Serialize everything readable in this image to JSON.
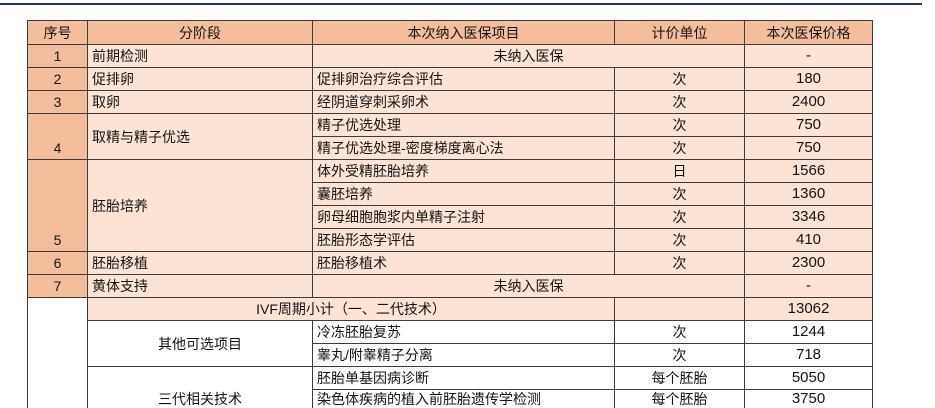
{
  "table": {
    "headers": {
      "index": "序号",
      "stage": "分阶段",
      "item": "本次纳入医保项目",
      "unit": "计价单位",
      "price": "本次医保价格"
    },
    "stages": [
      {
        "index": "1",
        "stage": "前期检测",
        "note": "未纳入医保",
        "price": "-"
      },
      {
        "index": "2",
        "stage": "促排卵",
        "items": [
          {
            "item": "促排卵治疗综合评估",
            "unit": "次",
            "price": "180"
          }
        ]
      },
      {
        "index": "3",
        "stage": "取卵",
        "items": [
          {
            "item": "经阴道穿刺采卵术",
            "unit": "次",
            "price": "2400"
          }
        ]
      },
      {
        "index": "4",
        "stage": "取精与精子优选",
        "items": [
          {
            "item": "精子优选处理",
            "unit": "次",
            "price": "750"
          },
          {
            "item": "精子优选处理-密度梯度离心法",
            "unit": "次",
            "price": "750"
          }
        ]
      },
      {
        "index": "5",
        "stage": "胚胎培养",
        "items": [
          {
            "item": "体外受精胚胎培养",
            "unit": "日",
            "price": "1566"
          },
          {
            "item": "囊胚培养",
            "unit": "次",
            "price": "1360"
          },
          {
            "item": "卵母细胞胞浆内单精子注射",
            "unit": "次",
            "price": "3346"
          },
          {
            "item": "胚胎形态学评估",
            "unit": "次",
            "price": "410"
          }
        ]
      },
      {
        "index": "6",
        "stage": "胚胎移植",
        "items": [
          {
            "item": "胚胎移植术",
            "unit": "次",
            "price": "2300"
          }
        ]
      },
      {
        "index": "7",
        "stage": "黄体支持",
        "note": "未纳入医保",
        "price": "-"
      }
    ],
    "subtotal": {
      "label": "IVF周期小计（一、二代技术）",
      "price": "13062"
    },
    "optional_groups": [
      {
        "group": "其他可选项目",
        "items": [
          {
            "item": "冷冻胚胎复苏",
            "unit": "次",
            "price": "1244"
          },
          {
            "item": "睾丸/附睾精子分离",
            "unit": "次",
            "price": "718"
          }
        ]
      },
      {
        "group": "三代相关技术",
        "items": [
          {
            "item": "胚胎单基因病诊断",
            "unit": "每个胚胎",
            "price": "5050"
          },
          {
            "item": "染色体疾病的植入前胚胎遗传学检测",
            "unit": "每个胚胎",
            "price": "3750"
          }
        ]
      }
    ]
  },
  "colors": {
    "header_fill": "#F4BE9D",
    "body_fill": "#FCE3D4",
    "grid_line": "#3C3C3C",
    "top_rule": "#1F3864",
    "blank_fill": "#FFFFFF"
  }
}
